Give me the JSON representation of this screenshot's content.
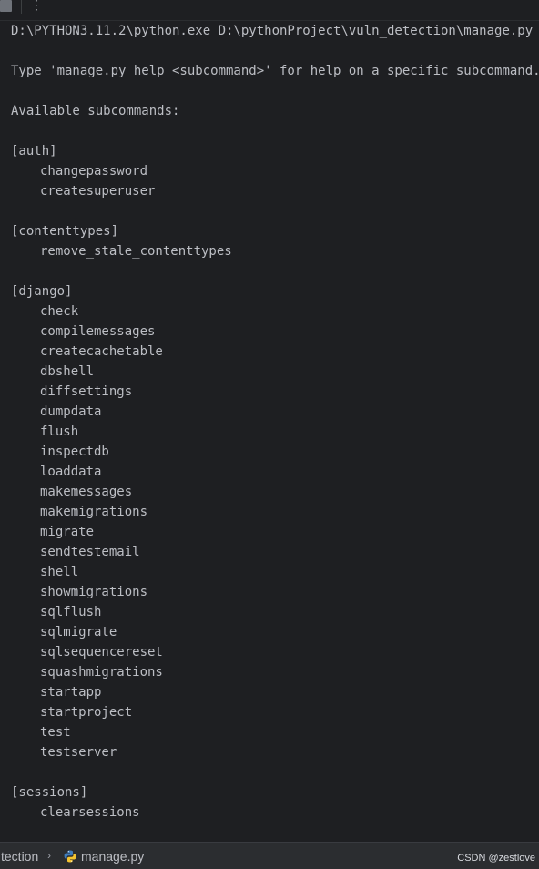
{
  "toolbar": {
    "more_icon": "⋮"
  },
  "console": {
    "command_line": "D:\\PYTHON3.11.2\\python.exe D:\\pythonProject\\vuln_detection\\manage.py",
    "help_hint": "Type 'manage.py help <subcommand>' for help on a specific subcommand.",
    "available_header": "Available subcommands:",
    "groups": [
      {
        "name": "[auth]",
        "commands": [
          "changepassword",
          "createsuperuser"
        ]
      },
      {
        "name": "[contenttypes]",
        "commands": [
          "remove_stale_contenttypes"
        ]
      },
      {
        "name": "[django]",
        "commands": [
          "check",
          "compilemessages",
          "createcachetable",
          "dbshell",
          "diffsettings",
          "dumpdata",
          "flush",
          "inspectdb",
          "loaddata",
          "makemessages",
          "makemigrations",
          "migrate",
          "sendtestemail",
          "shell",
          "showmigrations",
          "sqlflush",
          "sqlmigrate",
          "sqlsequencereset",
          "squashmigrations",
          "startapp",
          "startproject",
          "test",
          "testserver"
        ]
      },
      {
        "name": "[sessions]",
        "commands": [
          "clearsessions"
        ]
      }
    ]
  },
  "statusbar": {
    "breadcrumb_folder": "tection",
    "breadcrumb_chevron": "›",
    "file_icon": "python-icon",
    "breadcrumb_file": "manage.py",
    "watermark": "CSDN @zestlove"
  },
  "colors": {
    "background": "#1e1f22",
    "text": "#bcbec4",
    "statusbar_bg": "#2b2d30",
    "python_blue": "#3f7cbc",
    "python_yellow": "#f4c430"
  }
}
